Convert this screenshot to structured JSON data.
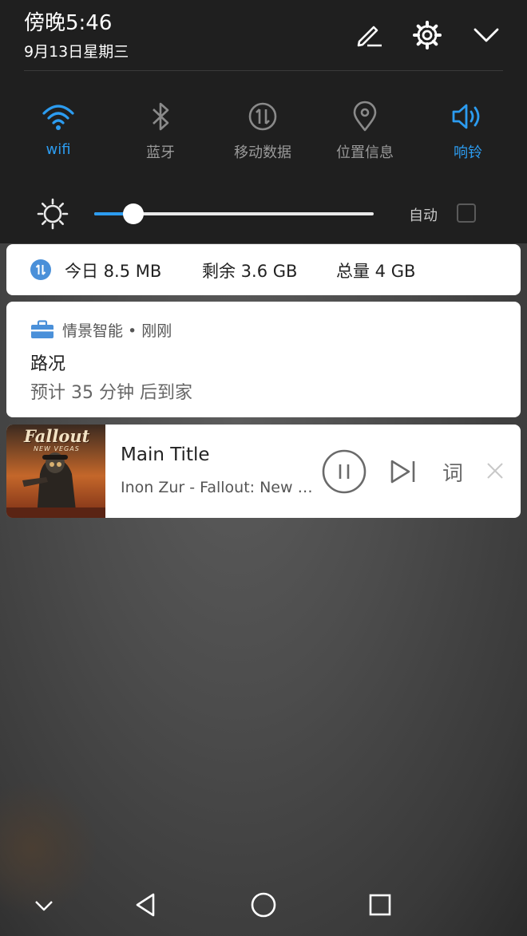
{
  "status": {
    "time": "傍晚5:46",
    "date": "9月13日星期三"
  },
  "header_icons": [
    "edit-icon",
    "settings-icon",
    "collapse-icon"
  ],
  "quick_settings": [
    {
      "label": "wifi",
      "icon": "wifi-icon",
      "active": true
    },
    {
      "label": "蓝牙",
      "icon": "bluetooth-icon",
      "active": false
    },
    {
      "label": "移动数据",
      "icon": "mobile-data-icon",
      "active": false
    },
    {
      "label": "位置信息",
      "icon": "location-icon",
      "active": false
    },
    {
      "label": "响铃",
      "icon": "volume-icon",
      "active": true
    }
  ],
  "brightness": {
    "level": 0.14,
    "auto_label": "自动",
    "auto_checked": false
  },
  "data_usage": {
    "today": "今日 8.5 MB",
    "remaining": "剩余 3.6 GB",
    "total": "总量 4 GB"
  },
  "smart_notification": {
    "app": "情景智能 • 刚刚",
    "title": "路况",
    "body": "预计 35 分钟 后到家"
  },
  "music": {
    "title": "Main Title",
    "artist": "Inon Zur - Fallout: New Vegas",
    "lyrics_label": "词",
    "album_title": "Fallout",
    "album_subtitle": "NEW VEGAS"
  },
  "navigation": [
    "chevron-down-icon",
    "back-icon",
    "home-icon",
    "recents-icon"
  ],
  "colors": {
    "accent": "#2c9cf0",
    "shade": "#1f1f1f",
    "card": "#ffffff"
  }
}
